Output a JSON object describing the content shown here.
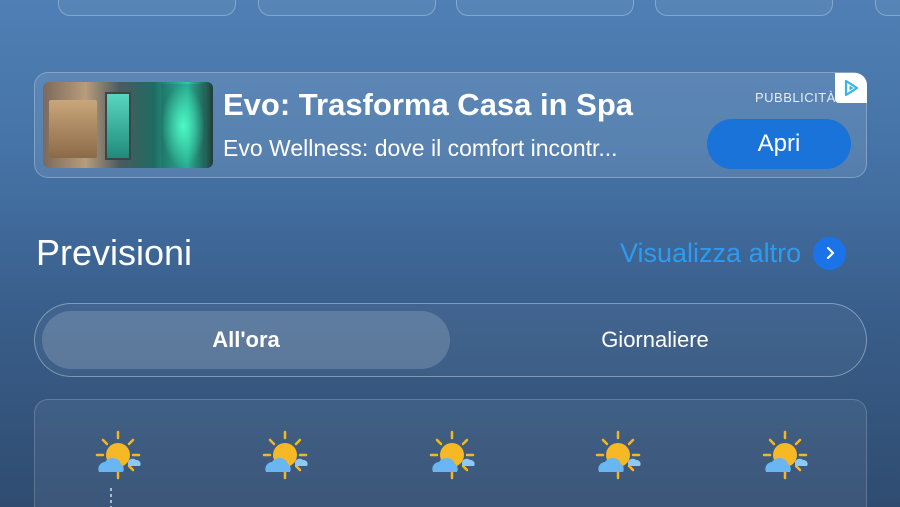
{
  "ad": {
    "title": "Evo: Trasforma Casa in Spa",
    "description": "Evo Wellness: dove il comfort incontr...",
    "tag": "PUBBLICITÀ",
    "cta": "Apri",
    "cta_color": "#1a73d9"
  },
  "forecast": {
    "title": "Previsioni",
    "see_more": "Visualizza altro",
    "see_more_color": "#2d9bf0",
    "tabs": [
      {
        "label": "All'ora",
        "active": true
      },
      {
        "label": "Giornaliere",
        "active": false
      }
    ],
    "hours": [
      {
        "icon": "partly-sunny-icon"
      },
      {
        "icon": "partly-sunny-icon"
      },
      {
        "icon": "partly-sunny-icon"
      },
      {
        "icon": "partly-sunny-icon"
      },
      {
        "icon": "partly-sunny-icon"
      }
    ]
  }
}
